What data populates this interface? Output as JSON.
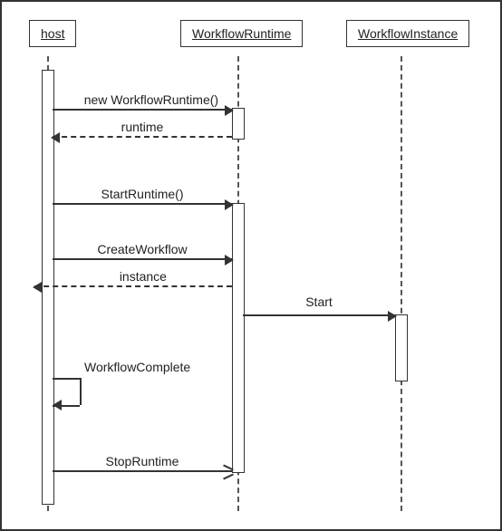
{
  "diagram": {
    "type": "uml-sequence",
    "participants": {
      "host": "host",
      "runtime": "WorkflowRuntime",
      "instance": "WorkflowInstance"
    },
    "messages": {
      "m1": "new WorkflowRuntime()",
      "r1": "runtime",
      "m2": "StartRuntime()",
      "m3": "CreateWorkflow",
      "r3": "instance",
      "m4": "Start",
      "m5": "WorkflowComplete",
      "m6": "StopRuntime"
    }
  },
  "chart_data": {
    "type": "sequence",
    "participants": [
      "host",
      "WorkflowRuntime",
      "WorkflowInstance"
    ],
    "interactions": [
      {
        "from": "host",
        "to": "WorkflowRuntime",
        "label": "new WorkflowRuntime()",
        "kind": "sync"
      },
      {
        "from": "WorkflowRuntime",
        "to": "host",
        "label": "runtime",
        "kind": "return"
      },
      {
        "from": "host",
        "to": "WorkflowRuntime",
        "label": "StartRuntime()",
        "kind": "sync"
      },
      {
        "from": "host",
        "to": "WorkflowRuntime",
        "label": "CreateWorkflow",
        "kind": "sync"
      },
      {
        "from": "WorkflowRuntime",
        "to": "host",
        "label": "instance",
        "kind": "return"
      },
      {
        "from": "WorkflowRuntime",
        "to": "WorkflowInstance",
        "label": "Start",
        "kind": "sync"
      },
      {
        "from": "host",
        "to": "host",
        "label": "WorkflowComplete",
        "kind": "self"
      },
      {
        "from": "host",
        "to": "WorkflowRuntime",
        "label": "StopRuntime",
        "kind": "sync"
      }
    ]
  }
}
